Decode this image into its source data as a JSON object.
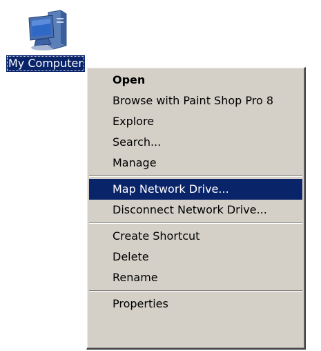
{
  "desktop": {
    "icon": {
      "name": "computer-icon",
      "label": "My Computer"
    }
  },
  "context_menu": {
    "highlight_color": "#0a246a",
    "background_color": "#d4d0c8",
    "groups": [
      [
        {
          "label": "Open",
          "bold": true
        },
        {
          "label": "Browse with Paint Shop Pro 8"
        },
        {
          "label": "Explore"
        },
        {
          "label": "Search..."
        },
        {
          "label": "Manage"
        }
      ],
      [
        {
          "label": "Map Network Drive...",
          "highlighted": true
        },
        {
          "label": "Disconnect Network Drive..."
        }
      ],
      [
        {
          "label": "Create Shortcut"
        },
        {
          "label": "Delete"
        },
        {
          "label": "Rename"
        }
      ],
      [
        {
          "label": "Properties"
        }
      ]
    ]
  }
}
